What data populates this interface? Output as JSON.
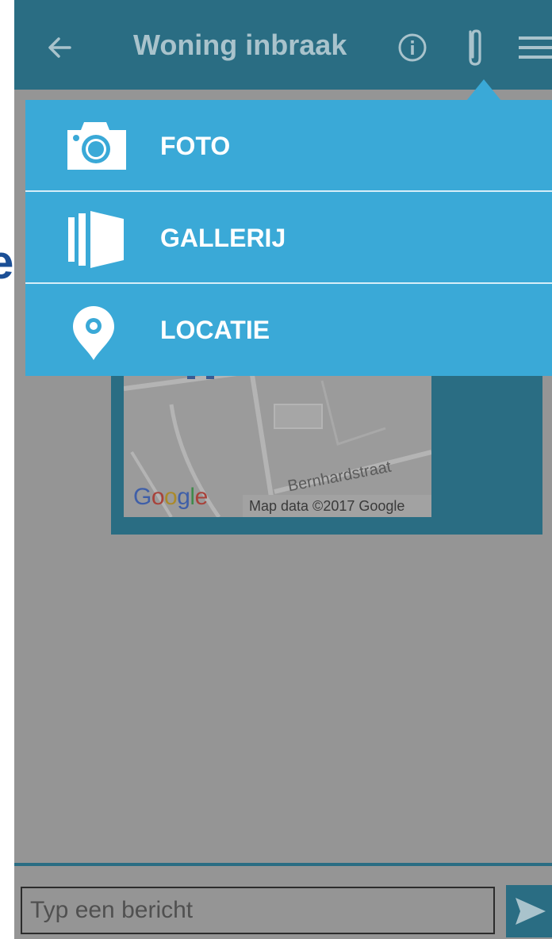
{
  "edge_glyph": "e",
  "header": {
    "title": "Woning inbraak",
    "back_icon": "arrow-left-icon",
    "info_icon": "info-circle-icon",
    "attach_icon": "paperclip-icon",
    "menu_icon": "hamburger-menu-icon"
  },
  "attach_menu": {
    "items": [
      {
        "label": "FOTO",
        "icon": "camera-icon"
      },
      {
        "label": "GALLERIJ",
        "icon": "gallery-icon"
      },
      {
        "label": "LOCATIE",
        "icon": "location-pin-icon"
      }
    ]
  },
  "map_message": {
    "street_label": "Bernhardstraat",
    "provider_logo": "Google",
    "attribution": "Map data ©2017 Google"
  },
  "composer": {
    "placeholder": "Typ een bericht",
    "value": "",
    "send_icon": "send-icon"
  },
  "colors": {
    "header_bg": "#2a6d83",
    "popup_bg": "#3aa9d7",
    "dim_overlay": "#959595"
  }
}
